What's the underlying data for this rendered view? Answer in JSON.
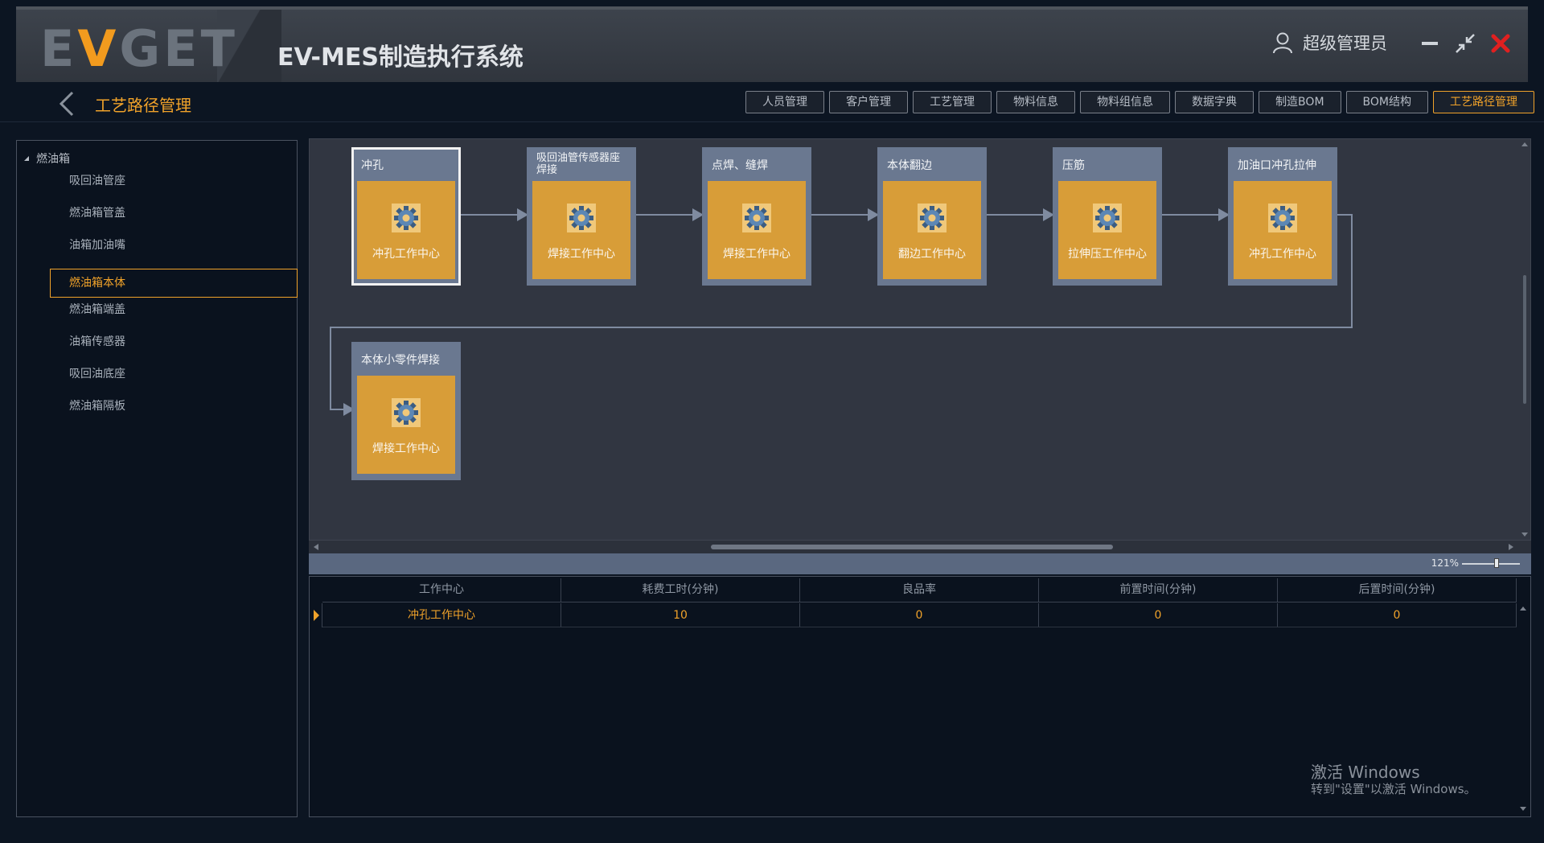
{
  "header": {
    "logo_prefix": "E",
    "logo_v": "V",
    "logo_suffix": "GET",
    "app_title": "EV-MES制造执行系统",
    "user_name": "超级管理员"
  },
  "subbar": {
    "page_title": "工艺路径管理",
    "tabs": [
      "人员管理",
      "客户管理",
      "工艺管理",
      "物料信息",
      "物料组信息",
      "数据字典",
      "制造BOM",
      "BOM结构",
      "工艺路径管理"
    ],
    "active_tab": "工艺路径管理"
  },
  "tree": {
    "root": "燃油箱",
    "items": [
      "吸回油管座",
      "燃油箱管盖",
      "油箱加油嘴",
      "燃油箱本体",
      "燃油箱端盖",
      "油箱传感器",
      "吸回油底座",
      "燃油箱隔板"
    ],
    "selected": "燃油箱本体"
  },
  "flow": {
    "nodes": [
      {
        "title": "冲孔",
        "center": "冲孔工作中心"
      },
      {
        "title": "吸回油管传感器座焊接",
        "center": "焊接工作中心"
      },
      {
        "title": "点焊、缝焊",
        "center": "焊接工作中心"
      },
      {
        "title": "本体翻边",
        "center": "翻边工作中心"
      },
      {
        "title": "压筋",
        "center": "拉伸压工作中心"
      },
      {
        "title": "加油口冲孔拉伸",
        "center": "冲孔工作中心"
      },
      {
        "title": "本体小零件焊接",
        "center": "焊接工作中心"
      }
    ],
    "zoom": "121%"
  },
  "grid": {
    "headers": [
      "工作中心",
      "耗费工时(分钟)",
      "良品率",
      "前置时间(分钟)",
      "后置时间(分钟)"
    ],
    "rows": [
      [
        "冲孔工作中心",
        "10",
        "0",
        "0",
        "0"
      ]
    ]
  },
  "watermark": {
    "line1": "激活 Windows",
    "line2": "转到\"设置\"以激活 Windows。"
  },
  "colors": {
    "accent": "#f0a22a",
    "node_body": "#d89d38",
    "node_frame": "#6a7890",
    "close": "#e02020"
  }
}
